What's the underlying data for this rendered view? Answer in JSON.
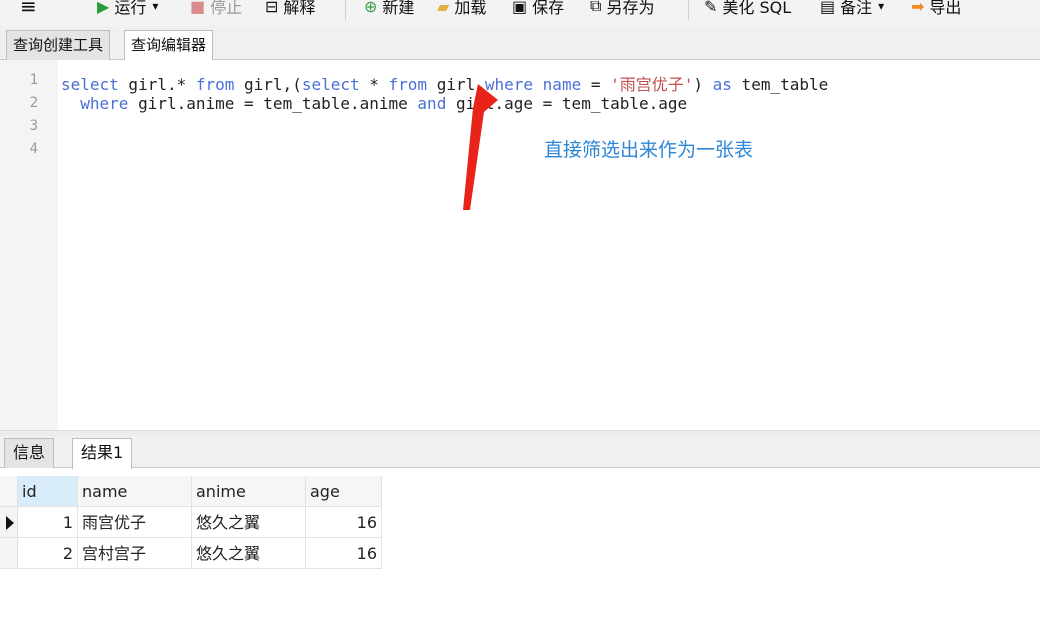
{
  "toolbar": {
    "menu_glyph": "≡",
    "run": {
      "icon": "play-icon",
      "glyph": "▶",
      "label": "运行",
      "dropdown": "▾",
      "color": "#2e9b3a"
    },
    "stop": {
      "icon": "stop-icon",
      "glyph": "■",
      "label": "停止",
      "color": "#d98c8c"
    },
    "explain": {
      "icon": "explain-icon",
      "glyph": "⊟",
      "label": "解释"
    },
    "new": {
      "icon": "new-icon",
      "glyph": "⊕",
      "label": "新建",
      "color": "#3aa04a"
    },
    "load": {
      "icon": "folder-icon",
      "glyph": "▰",
      "label": "加载",
      "color": "#e0b040"
    },
    "save": {
      "icon": "save-icon",
      "glyph": "▣",
      "label": "保存"
    },
    "save_as": {
      "icon": "save-as-icon",
      "glyph": "⧉",
      "label": "另存为"
    },
    "beautify": {
      "icon": "wand-icon",
      "glyph": "✎",
      "label": "美化 SQL"
    },
    "comment": {
      "icon": "note-icon",
      "glyph": "▤",
      "label": "备注",
      "dropdown": "▾"
    },
    "export": {
      "icon": "export-icon",
      "glyph": "➡",
      "label": "导出",
      "color": "#f08a24"
    }
  },
  "tabs": [
    {
      "label": "查询创建工具",
      "active": false
    },
    {
      "label": "查询编辑器",
      "active": true
    }
  ],
  "editor": {
    "line_numbers": [
      "1",
      "2",
      "3",
      "4"
    ],
    "lines": [
      [
        {
          "t": "select",
          "k": "kw"
        },
        {
          "t": " girl.* "
        },
        {
          "t": "from",
          "k": "kw"
        },
        {
          "t": " girl,("
        },
        {
          "t": "select",
          "k": "kw"
        },
        {
          "t": " * "
        },
        {
          "t": "from",
          "k": "kw"
        },
        {
          "t": " girl "
        },
        {
          "t": "where",
          "k": "kw"
        },
        {
          "t": " "
        },
        {
          "t": "name",
          "k": "kw"
        },
        {
          "t": " = "
        },
        {
          "t": "'雨宫优子'",
          "k": "str"
        },
        {
          "t": ") "
        },
        {
          "t": "as",
          "k": "kw"
        },
        {
          "t": " tem_table"
        }
      ],
      [
        {
          "t": "  "
        },
        {
          "t": "where",
          "k": "kw"
        },
        {
          "t": " girl.anime = tem_table.anime "
        },
        {
          "t": "and",
          "k": "kw"
        },
        {
          "t": " girl.age = tem_table.age"
        }
      ],
      [],
      []
    ],
    "annotation": "直接筛选出来作为一张表",
    "annotation_color": "#2d86d6",
    "arrow_color": "#e8231a"
  },
  "result_tabs": [
    {
      "label": "信息",
      "active": false
    },
    {
      "label": "结果1",
      "active": true
    }
  ],
  "results": {
    "columns": [
      "id",
      "name",
      "anime",
      "age"
    ],
    "rows": [
      [
        "1",
        "雨宫优子",
        "悠久之翼",
        "16"
      ],
      [
        "2",
        "宫村宫子",
        "悠久之翼",
        "16"
      ]
    ]
  }
}
